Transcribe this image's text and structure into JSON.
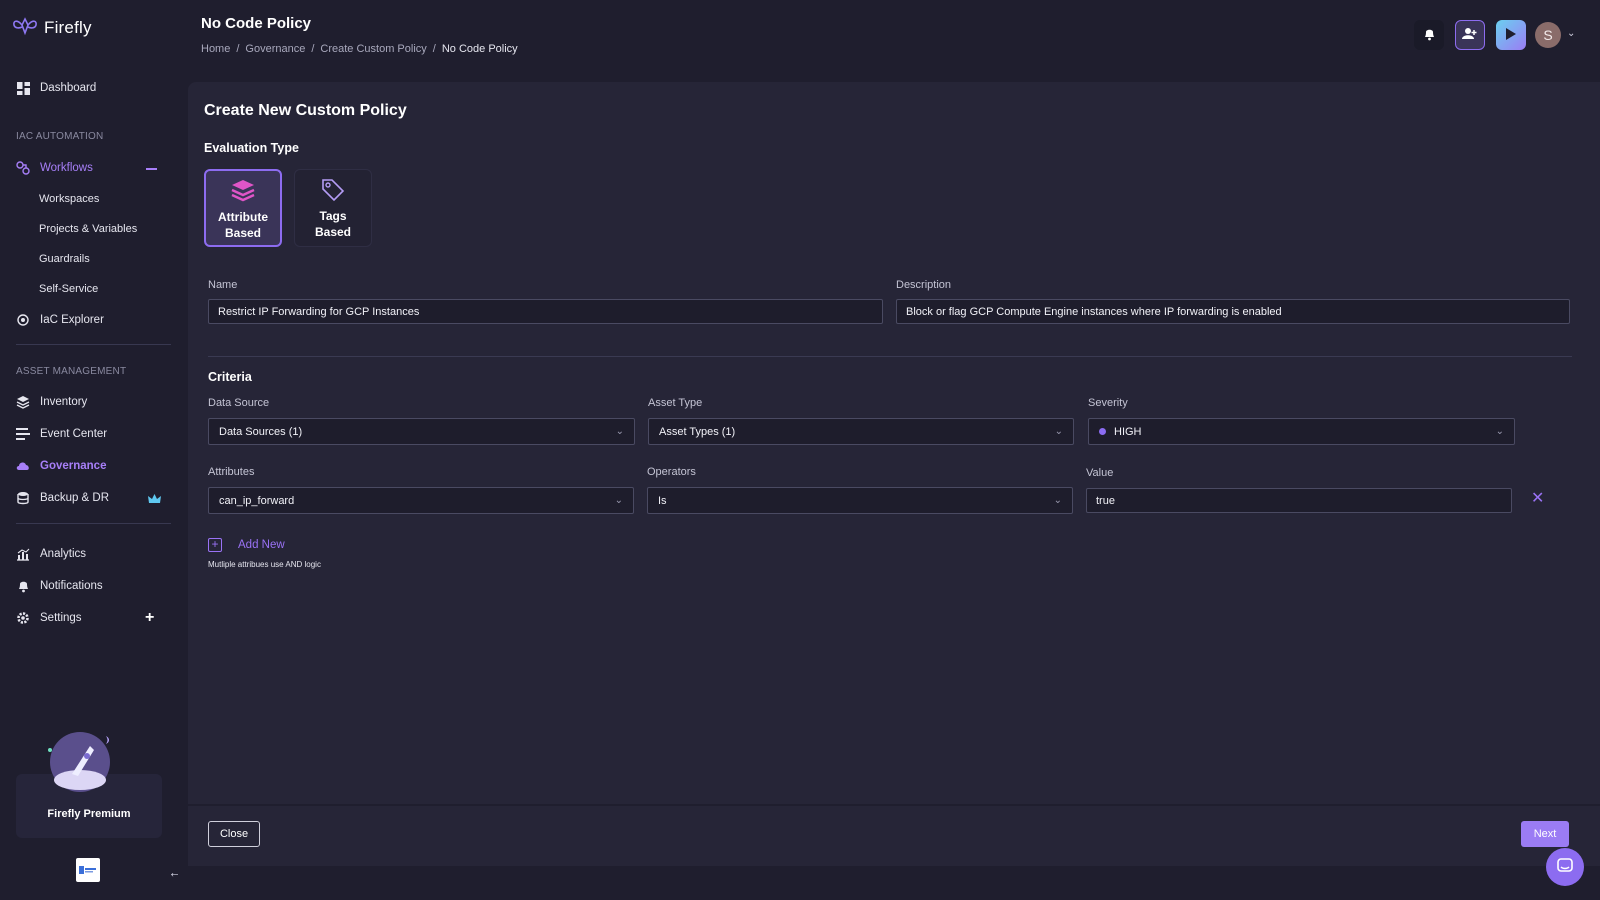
{
  "app": {
    "name": "Firefly"
  },
  "header": {
    "title": "No Code Policy",
    "breadcrumb": [
      "Home",
      "Governance",
      "Create Custom Policy",
      "No Code Policy"
    ],
    "separator": "/",
    "avatar_initial": "S"
  },
  "sidebar": {
    "dashboard": "Dashboard",
    "iac_section": "IAC AUTOMATION",
    "workflows": "Workflows",
    "workflow_children": [
      "Workspaces",
      "Projects & Variables",
      "Guardrails",
      "Self-Service"
    ],
    "iac_explorer": "IaC Explorer",
    "asset_section": "ASSET MANAGEMENT",
    "inventory": "Inventory",
    "event_center": "Event Center",
    "governance": "Governance",
    "backup": "Backup & DR",
    "analytics": "Analytics",
    "notifications": "Notifications",
    "settings": "Settings",
    "premium": "Firefly Premium"
  },
  "form": {
    "title": "Create New Custom Policy",
    "eval_type_label": "Evaluation Type",
    "eval_types": [
      {
        "label_line1": "Attribute",
        "label_line2": "Based",
        "selected": true
      },
      {
        "label_line1": "Tags",
        "label_line2": "Based",
        "selected": false
      }
    ],
    "name_label": "Name",
    "name_value": "Restrict IP Forwarding for GCP Instances",
    "description_label": "Description",
    "description_value": "Block or flag GCP Compute Engine instances where IP forwarding is enabled",
    "criteria_label": "Criteria",
    "data_source_label": "Data Source",
    "data_source_value": "Data Sources (1)",
    "asset_type_label": "Asset Type",
    "asset_type_value": "Asset Types (1)",
    "severity_label": "Severity",
    "severity_value": "HIGH",
    "attributes_label": "Attributes",
    "attributes_value": "can_ip_forward",
    "operators_label": "Operators",
    "operators_value": "Is",
    "value_label": "Value",
    "value_value": "true",
    "add_new": "Add New",
    "helper": "Mutliple attribues use AND logic"
  },
  "footer": {
    "close": "Close",
    "next": "Next"
  },
  "colors": {
    "accent": "#9b7cf4",
    "background": "#1f1e2e",
    "panel": "#262537"
  }
}
